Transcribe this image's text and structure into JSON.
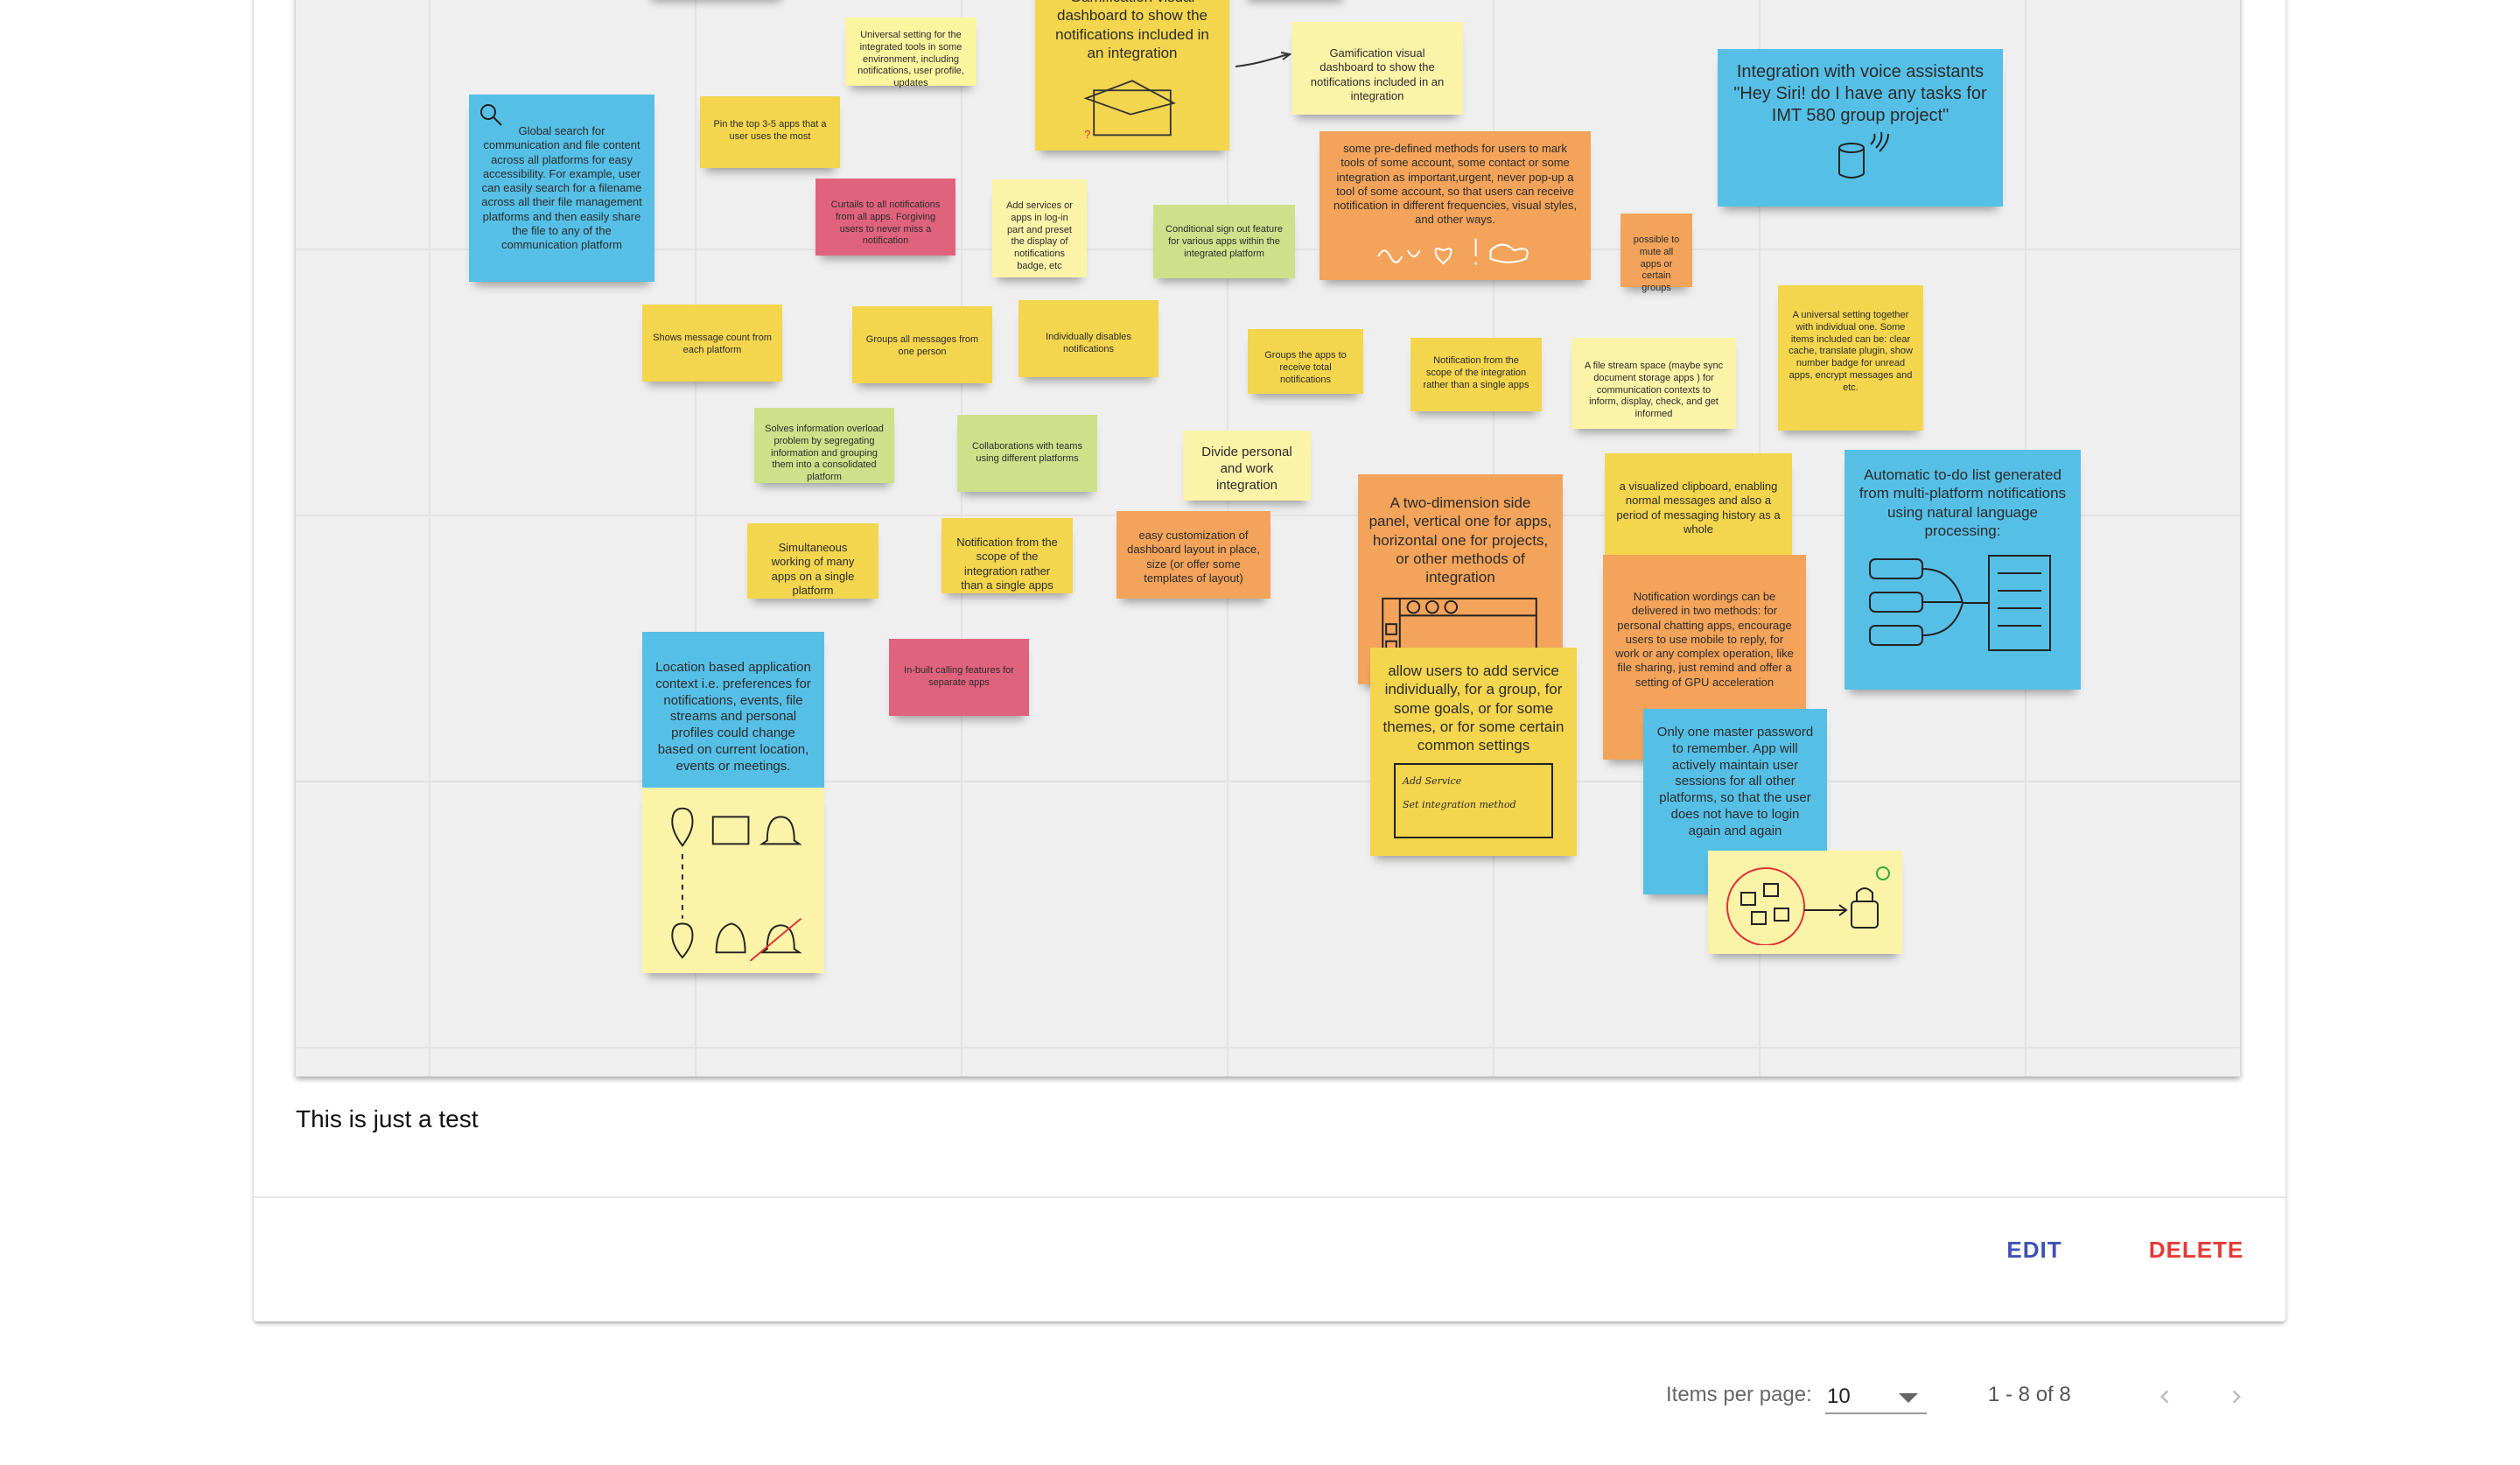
{
  "notes": {
    "n1": "Universal setting for the integrated tools in some environment, including notifications, user profile, updates",
    "n2": "Gamification visual dashboard to show the notifications included in an integration",
    "n3": "Gamification visual dashboard to show the notifications included in an integration",
    "n4": "Integration with voice assistants \"Hey Siri! do I have any tasks for IMT 580 group project\"",
    "n5": "Global search for communication and file content across all platforms for easy accessibility. For example, user can easily search for a filename across all their file management platforms and then easily share the file to any of the communication platform",
    "n6": "Pin the top 3-5 apps that a user uses the most",
    "n7": "Curtails to all notifications from all apps. Forgiving users to never miss a notification",
    "n8": "Add services or apps in log-in part and preset the display of notifications badge, etc",
    "n9": "Conditional sign out feature for various apps within the integrated platform",
    "n10": "some pre-defined methods for users to mark tools of some account, some contact or some integration as important,urgent, never pop-up a tool of some account, so that users can receive notification in different frequencies, visual styles, and other ways.",
    "n11": "possible to mute all apps or certain groups",
    "n12": "Shows message count from each platform",
    "n13": "Groups all messages from one person",
    "n14": "Individually disables notifications",
    "n15": "Groups the apps to receive total notifications",
    "n16": "Notification from the scope of the integration rather than a single apps",
    "n17": "A file stream space (maybe sync document storage apps ) for communication contexts to inform, display, check, and get informed",
    "n18": "A universal setting together with individual one. Some items included can be: clear cache, translate plugin, show number badge for unread apps, encrypt messages and etc.",
    "n19": "Solves information overload problem by segregating information and grouping them into a consolidated platform",
    "n20": "Collaborations with teams using different platforms",
    "n21": "Divide personal and work integration",
    "n22": "A two-dimension side panel, vertical one for apps, horizontal one for projects, or other methods of integration",
    "n23": "a visualized clipboard, enabling normal messages and also a period of messaging history as a whole",
    "n24": "Automatic to-do list generated from multi-platform notifications using natural language processing:",
    "n25": "Simultaneous working of many apps on a single platform",
    "n26": "Notification from the scope of the integration rather than a single apps",
    "n27": "easy customization of dashboard layout in place, size (or offer some templates of layout)",
    "n28": "Notification wordings can be delivered in two methods: for personal chatting apps, encourage users to use mobile to reply, for work or any complex operation, like file sharing, just remind and offer a setting of GPU acceleration",
    "n29": "Location based application context i.e. preferences for notifications, events, file streams and personal profiles could change based on current location, events or meetings.",
    "n30": "In-built calling features for separate apps",
    "n31": "allow users to add service individually, for a group, for some goals, or for some themes, or for some certain common settings",
    "n31a": "Add Service",
    "n31b": "Set integration method",
    "n32": "Only one master password to remember. App will actively maintain user sessions for all other platforms, so that the user does not have to login again and again"
  },
  "caption": "This is just a test",
  "actions": {
    "edit": "EDIT",
    "delete": "DELETE"
  },
  "paginator": {
    "items_per_page_label": "Items per page:",
    "items_per_page_value": "10",
    "range": "1 - 8 of 8"
  },
  "colors": {
    "edit": "#3f51b5",
    "delete": "#e53935"
  }
}
